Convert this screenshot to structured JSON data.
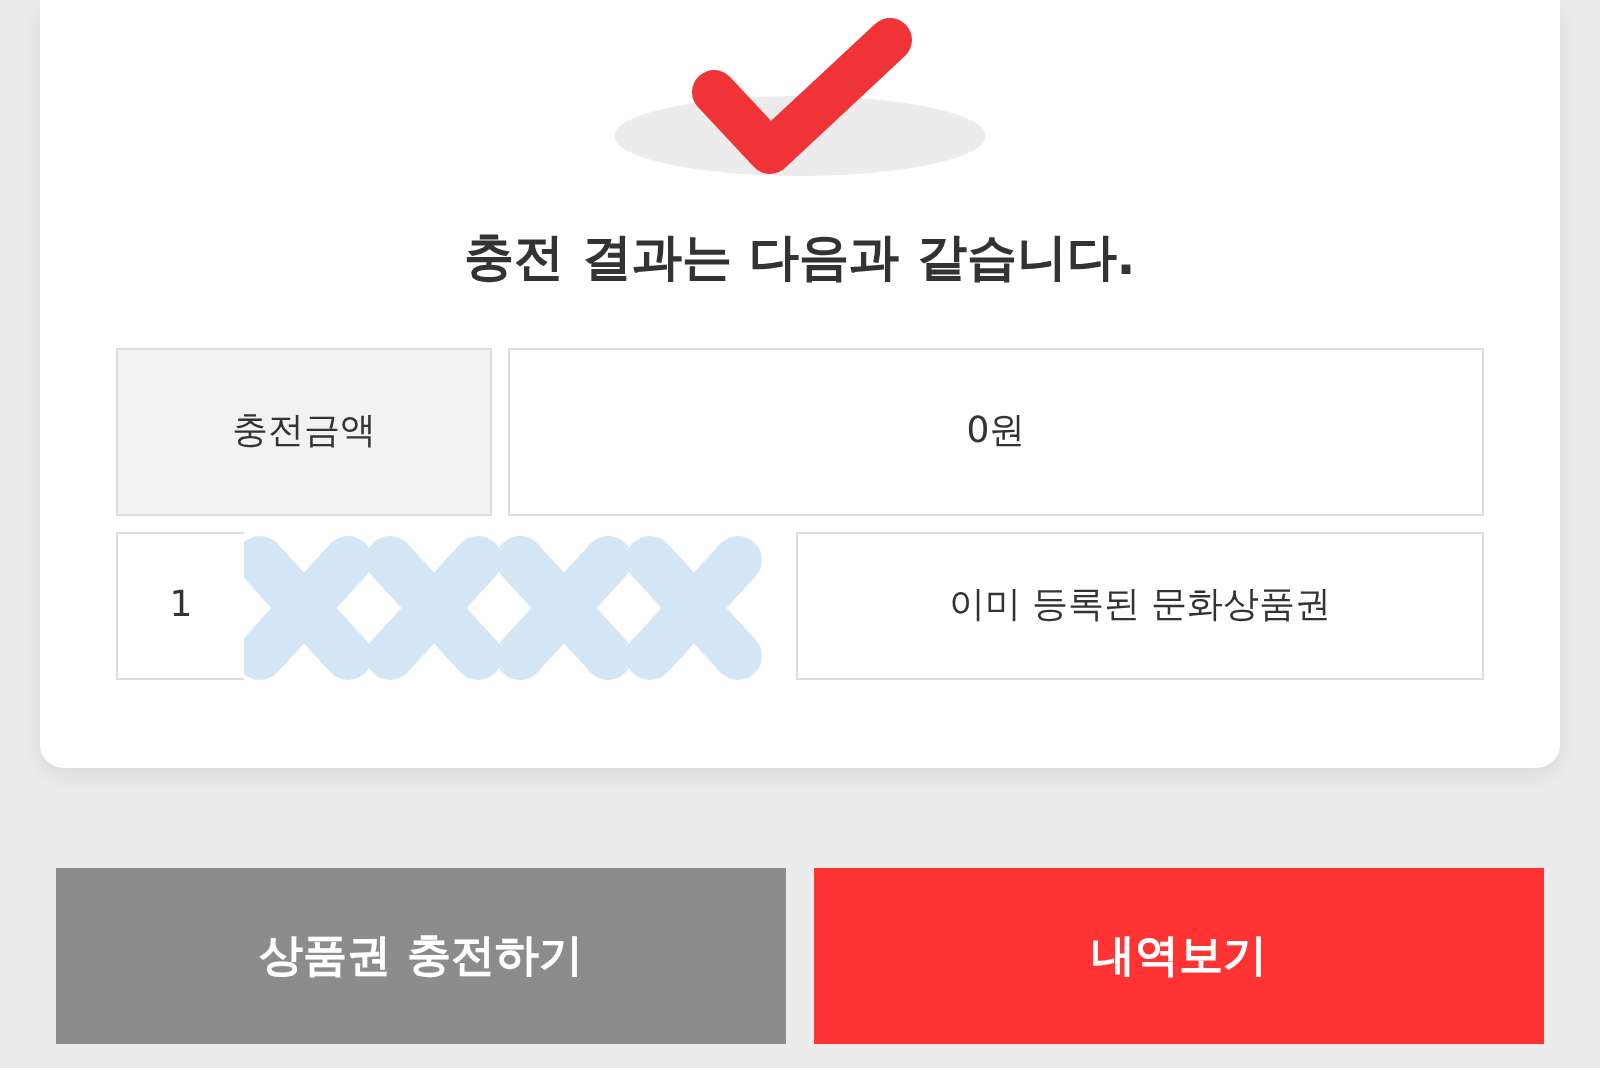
{
  "result_card": {
    "title": "충전 결과는 다음과 같습니다.",
    "amount_row": {
      "label": "충전금액",
      "value": "0원"
    },
    "voucher_rows": [
      {
        "number": "1",
        "status": "이미 등록된 문화상품권"
      }
    ]
  },
  "buttons": [
    {
      "label": "상품권 충전하기",
      "kind": "secondary"
    },
    {
      "label": "내역보기",
      "kind": "primary"
    }
  ]
}
